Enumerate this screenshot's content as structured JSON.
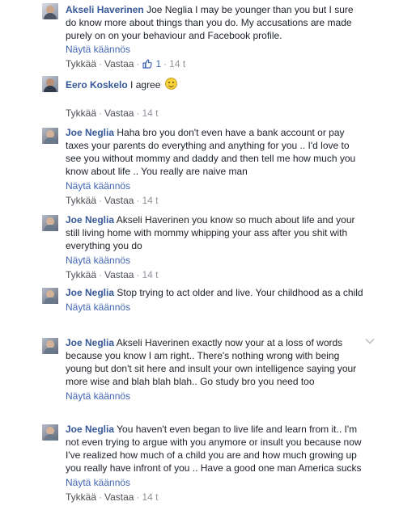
{
  "comments": [
    {
      "author": "Akseli Haverinen",
      "text": "Joe Neglia I may be younger than you but I sure do know more about things than you do. My accusations are made purely on on your behaviour and Facebook profile.",
      "translate_label": "Näytä käännös",
      "like_label": "Tykkää",
      "reply_label": "Vastaa",
      "reaction_count": "1",
      "time": "14 t",
      "avatar_icon": "profile-photo"
    },
    {
      "author": "Eero Koskelo",
      "text": "I agree",
      "emoji": "smiley-emoji",
      "like_label": "Tykkää",
      "reply_label": "Vastaa",
      "time": "14 t",
      "avatar_icon": "profile-photo"
    },
    {
      "author": "Joe Neglia",
      "text": "Haha bro you don't even have a bank account or pay taxes your parents do everything and anything for you .. I'd love to see you without mommy and daddy and then tell me how much you know about life .. You really are naive man",
      "translate_label": "Näytä käännös",
      "like_label": "Tykkää",
      "reply_label": "Vastaa",
      "time": "14 t",
      "avatar_icon": "profile-photo"
    },
    {
      "author": "Joe Neglia",
      "text": "Akseli Haverinen you know so much about life and your still living home with mommy whipping your ass after you shit with everything you do",
      "translate_label": "Näytä käännös",
      "like_label": "Tykkää",
      "reply_label": "Vastaa",
      "time": "14 t",
      "avatar_icon": "profile-photo"
    },
    {
      "author": "Joe Neglia",
      "text": "Stop trying to act older and live. Your childhood as a child",
      "translate_label": "Näytä käännös",
      "avatar_icon": "profile-photo"
    },
    {
      "author": "Joe Neglia",
      "text": "Akseli Haverinen exactly now your at a loss of words because you know I am right.. There's nothing wrong with being young but don't sit here and insult your own intelligence saying your more wise and blah blah blah.. Go study bro you need too",
      "translate_label": "Näytä käännös",
      "options_icon": "chevron-down-icon",
      "avatar_icon": "profile-photo"
    },
    {
      "author": "Joe Neglia",
      "text": "You haven't even began to live life and learn from it.. I'm not even trying to argue with you anymore or insult you because now I've realized how much of a child you are and how much growing up you really have infront of you .. Have a good one man America sucks",
      "translate_label": "Näytä käännös",
      "like_label": "Tykkää",
      "reply_label": "Vastaa",
      "time": "14 t",
      "avatar_icon": "profile-photo"
    }
  ],
  "colors": {
    "author_link": "#365899",
    "translate_link": "#4267b2",
    "meta_text": "#90949c",
    "body_text": "#1d2129",
    "like_badge": "#4267b2"
  }
}
